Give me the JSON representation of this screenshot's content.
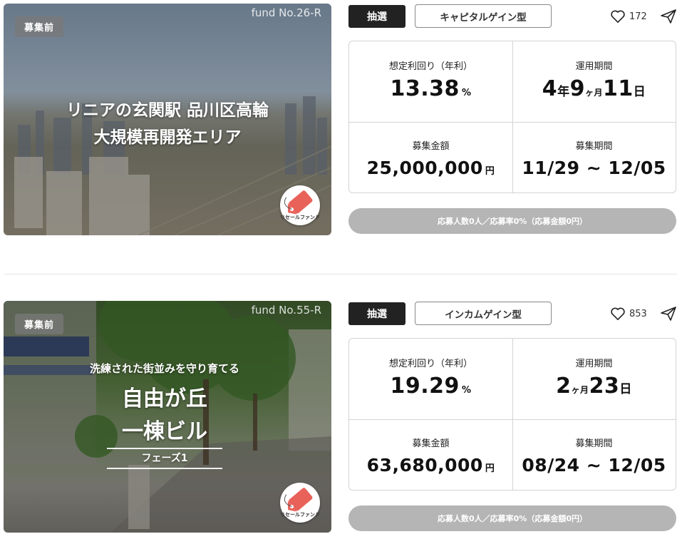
{
  "funds": [
    {
      "status": "募集前",
      "fund_no": "fund No.26-R",
      "headline_line1": "リニアの玄関駅 品川区高輪",
      "headline_line2": "大規模再開発エリア",
      "resale_label": "リセールファンド",
      "lottery_label": "抽選",
      "type_label": "キャピタルゲイン型",
      "likes": "172",
      "stats": {
        "yield_label": "想定利回り（年利）",
        "yield_value": "13.38",
        "yield_unit": "%",
        "period_label": "運用期間",
        "period_parts": [
          "4",
          "年",
          "9",
          "ヶ月",
          "11",
          "日"
        ],
        "amount_label": "募集金額",
        "amount_value": "25,000,000",
        "amount_unit": "円",
        "recruit_label": "募集期間",
        "recruit_value": "11/29 ~ 12/05"
      },
      "application_status": "応募人数0人／応募率0%（応募金額0円）"
    },
    {
      "status": "募集前",
      "fund_no": "fund No.55-R",
      "headline_sub": "洗練された街並みを守り育てる",
      "headline_line1": "自由が丘",
      "headline_line2": "一棟ビル",
      "phase_label": "フェーズ1",
      "resale_label": "リセールファンド",
      "lottery_label": "抽選",
      "type_label": "インカムゲイン型",
      "likes": "853",
      "stats": {
        "yield_label": "想定利回り（年利）",
        "yield_value": "19.29",
        "yield_unit": "%",
        "period_label": "運用期間",
        "period_parts": [
          "2",
          "ヶ月",
          "23",
          "日"
        ],
        "amount_label": "募集金額",
        "amount_value": "63,680,000",
        "amount_unit": "円",
        "recruit_label": "募集期間",
        "recruit_value": "08/24 ~ 12/05"
      },
      "application_status": "応募人数0人／応募率0%（応募金額0円）"
    }
  ],
  "colors": {
    "tag_dark": "#222222",
    "application_bar": "#b5b5b5",
    "resale_icon": "#e8625a"
  },
  "icons": {
    "like": "heart-icon",
    "share": "paper-plane-icon",
    "resale": "price-tag-icon"
  }
}
